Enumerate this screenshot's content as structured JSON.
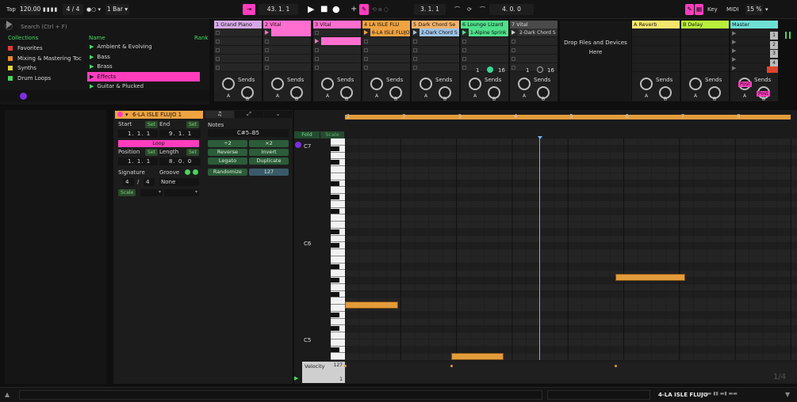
{
  "transport": {
    "tap": "Tap",
    "tempo": "120.00",
    "signature": "4 / 4",
    "quantize": "1 Bar",
    "position": "43.   1.   1",
    "loop_start": "3.   1.   1",
    "loop_length": "4.   0.   0",
    "key_label": "Key",
    "midi_label": "MIDI",
    "cpu": "15 %"
  },
  "browser": {
    "search_placeholder": "Search (Ctrl + F)",
    "collections_header": "Collections",
    "name_header": "Name",
    "rank_header": "Rank",
    "collections": [
      {
        "label": "Favorites",
        "color": "#e23b3b"
      },
      {
        "label": "Mixing & Mastering Toc",
        "color": "#e8892c"
      },
      {
        "label": "Synths",
        "color": "#e0d440"
      },
      {
        "label": "Drum Loops",
        "color": "#4bd35c"
      }
    ],
    "items": [
      "Ambient & Evolving",
      "Bass",
      "Brass",
      "Effects",
      "Guitar & Plucked"
    ],
    "selected_index": 3
  },
  "tracks": [
    {
      "name": "1 Grand Piano",
      "color": "#d6a8e6",
      "clip": "",
      "clip_color": "",
      "row": -1
    },
    {
      "name": "2 Vital",
      "color": "#ff6fcf",
      "clip": "",
      "clip_color": "#ff6fcf",
      "row": 0
    },
    {
      "name": "3 Vital",
      "color": "#ff6fcf",
      "clip": "",
      "clip_color": "#ff6fcf",
      "row": 1
    },
    {
      "name": "4 LA ISLE FLU",
      "color": "#f0a340",
      "clip": "6-LA ISLE FLUJO",
      "clip_color": "#f0a340",
      "row": 0
    },
    {
      "name": "5 Dark Chord Se",
      "color": "#f5b169",
      "clip": "2-Dark Chord S",
      "clip_color": "#9dc3e6",
      "row": 0
    },
    {
      "name": "6 Lounge Lizard",
      "color": "#4ee08a",
      "clip": "1-Alpine Sprink",
      "clip_color": "#4ee08a",
      "row": 0
    },
    {
      "name": "7 Vital",
      "color": "#4a4a4a",
      "clip": "2-Dark Chord S",
      "clip_color": "#303030",
      "row": 0
    }
  ],
  "drop_text": "Drop Files and Devices\nHere",
  "returns": [
    {
      "name": "A Reverb",
      "color": "#f6e66e"
    },
    {
      "name": "B Delay",
      "color": "#b8ef3c"
    },
    {
      "name": "Master",
      "color": "#6ee0d6"
    }
  ],
  "scene_numbers": [
    "1",
    "2",
    "3",
    "4"
  ],
  "sends_label": "Sends",
  "sends_a": "A",
  "sends_b": "B",
  "post_label": "Post",
  "midi_io": [
    "1",
    "16",
    "1",
    "16"
  ],
  "clip": {
    "name": "6-LA ISLE FLUJO 1",
    "start_label": "Start",
    "end_label": "End",
    "set_label": "Set",
    "start": "1.   1.   1",
    "end": "9.   1.   1",
    "loop_label": "Loop",
    "position_label": "Position",
    "length_label": "Length",
    "position": "1.   1.   1",
    "length": "8.   0.   0",
    "signature_label": "Signature",
    "groove_label": "Groove",
    "sig_num": "4",
    "sig_den": "4",
    "groove": "None",
    "scale_label": "Scale"
  },
  "notes_panel": {
    "title": "Notes",
    "range": "C#5–B5",
    "buttons": [
      "÷2",
      "×2",
      "Reverse",
      "Invert",
      "Legato",
      "Duplicate",
      "Randomize",
      "127"
    ]
  },
  "roll": {
    "fold": "Fold",
    "scale": "Scale",
    "bars": [
      "1",
      "2",
      "3",
      "4",
      "5",
      "6",
      "7",
      "8"
    ],
    "pitch_labels": [
      "C7",
      "C6",
      "C5"
    ],
    "velocity_label": "Velocity",
    "velocity_max": "127",
    "velocity_min": "1",
    "page": "1/4",
    "notes": [
      {
        "bar_start": 1.0,
        "bar_len": 0.95,
        "pitch": "B5"
      },
      {
        "bar_start": 2.9,
        "bar_len": 0.95,
        "pitch": "C#5"
      },
      {
        "bar_start": 5.85,
        "bar_len": 1.25,
        "pitch": "C#6"
      }
    ]
  },
  "status": {
    "track_name": "4-LA ISLE FLUJO"
  }
}
